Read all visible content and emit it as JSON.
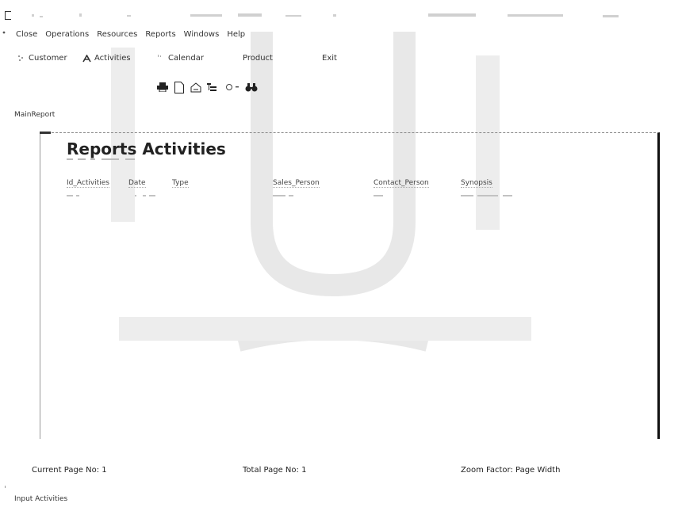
{
  "menu": {
    "items": [
      "Close",
      "Operations",
      "Resources",
      "Reports",
      "Windows",
      "Help"
    ]
  },
  "nav": {
    "items": [
      {
        "label": "Customer",
        "icon": "customer-icon"
      },
      {
        "label": "Activities",
        "icon": "activities-icon"
      },
      {
        "label": "Calendar",
        "icon": "calendar-icon"
      },
      {
        "label": "Product",
        "icon": "product-icon"
      },
      {
        "label": "Exit",
        "icon": "exit-icon"
      }
    ]
  },
  "toolbar": {
    "icons": [
      "print-icon",
      "page-icon",
      "export-icon",
      "tree-icon",
      "zoom-icon",
      "dropdown-arrow-icon",
      "find-icon"
    ]
  },
  "panel": {
    "label": "MainReport"
  },
  "report": {
    "title": "Reports Activities",
    "columns": [
      "Id_Activities",
      "Date",
      "Type",
      "Sales_Person",
      "Contact_Person",
      "Synopsis"
    ]
  },
  "status": {
    "current_page": "Current Page No: 1",
    "total_page": "Total Page No: 1",
    "zoom": "Zoom Factor: Page Width"
  },
  "footer": {
    "label": "Input Activities"
  },
  "colors": {
    "accent": "#111111",
    "watermark": "#e6e6e6"
  }
}
